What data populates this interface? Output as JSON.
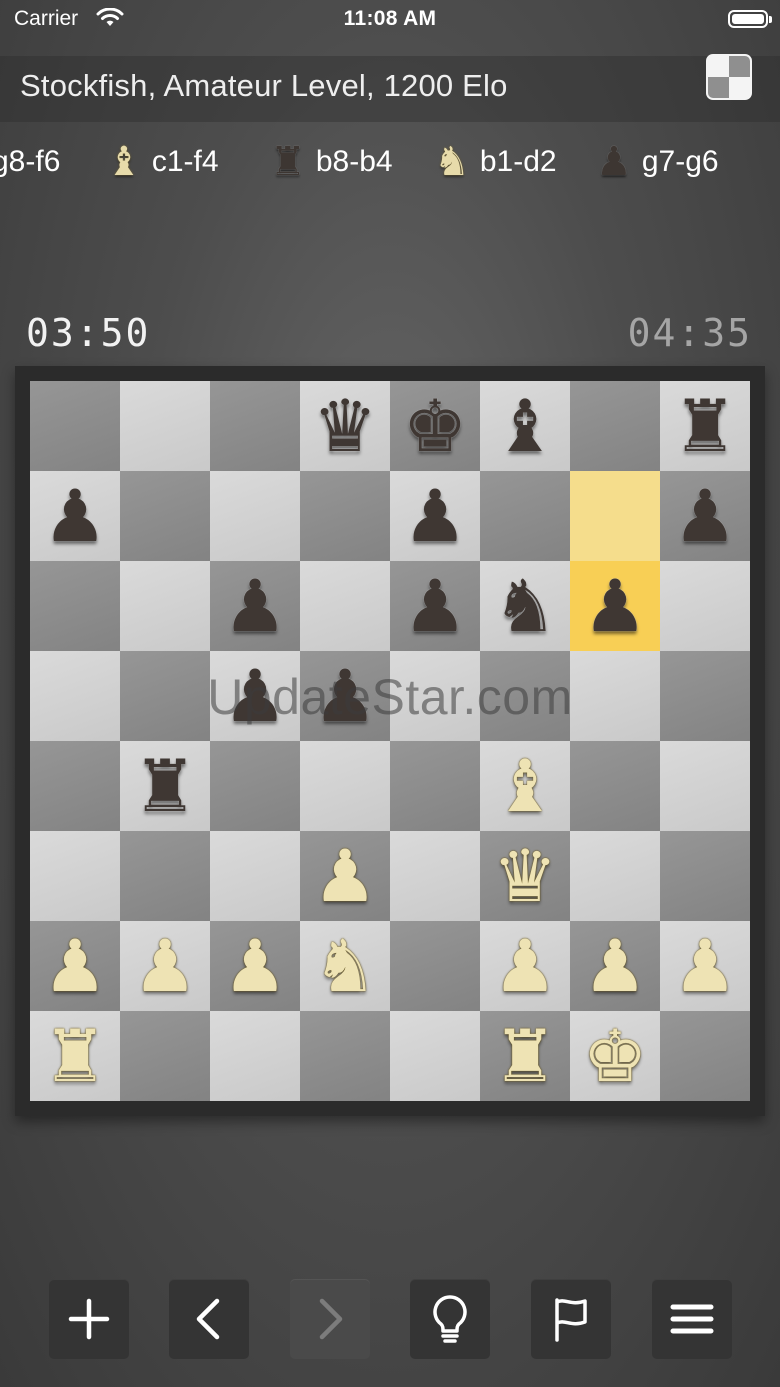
{
  "status_bar": {
    "carrier": "Carrier",
    "time": "11:08 AM"
  },
  "header": {
    "title": "Stockfish, Amateur Level, 1200 Elo"
  },
  "moves": [
    {
      "text": "g8-f6",
      "piece_icon": "none",
      "color": "black"
    },
    {
      "text": "c1-f4",
      "piece_icon": "bishop-icon",
      "color": "white"
    },
    {
      "text": "b8-b4",
      "piece_icon": "rook-icon",
      "color": "black"
    },
    {
      "text": "b1-d2",
      "piece_icon": "knight-icon",
      "color": "white"
    },
    {
      "text": "g7-g6",
      "piece_icon": "pawn-icon",
      "color": "black"
    }
  ],
  "timers": {
    "black": "03:50",
    "white": "04:35"
  },
  "board": {
    "last_move": {
      "from": "g7",
      "to": "g6"
    },
    "pieces": [
      {
        "square": "d8",
        "type": "queen",
        "color": "black"
      },
      {
        "square": "e8",
        "type": "king",
        "color": "black"
      },
      {
        "square": "f8",
        "type": "bishop",
        "color": "black"
      },
      {
        "square": "h8",
        "type": "rook",
        "color": "black"
      },
      {
        "square": "a7",
        "type": "pawn",
        "color": "black"
      },
      {
        "square": "e7",
        "type": "pawn",
        "color": "black"
      },
      {
        "square": "h7",
        "type": "pawn",
        "color": "black"
      },
      {
        "square": "c6",
        "type": "pawn",
        "color": "black"
      },
      {
        "square": "e6",
        "type": "pawn",
        "color": "black"
      },
      {
        "square": "f6",
        "type": "knight",
        "color": "black"
      },
      {
        "square": "g6",
        "type": "pawn",
        "color": "black"
      },
      {
        "square": "c5",
        "type": "pawn",
        "color": "black"
      },
      {
        "square": "d5",
        "type": "pawn",
        "color": "black"
      },
      {
        "square": "b4",
        "type": "rook",
        "color": "black"
      },
      {
        "square": "f4",
        "type": "bishop",
        "color": "white"
      },
      {
        "square": "d3",
        "type": "pawn",
        "color": "white"
      },
      {
        "square": "f3",
        "type": "queen",
        "color": "white"
      },
      {
        "square": "a2",
        "type": "pawn",
        "color": "white"
      },
      {
        "square": "b2",
        "type": "pawn",
        "color": "white"
      },
      {
        "square": "c2",
        "type": "pawn",
        "color": "white"
      },
      {
        "square": "d2",
        "type": "knight",
        "color": "white"
      },
      {
        "square": "f2",
        "type": "pawn",
        "color": "white"
      },
      {
        "square": "g2",
        "type": "pawn",
        "color": "white"
      },
      {
        "square": "h2",
        "type": "pawn",
        "color": "white"
      },
      {
        "square": "a1",
        "type": "rook",
        "color": "white"
      },
      {
        "square": "f1",
        "type": "rook",
        "color": "white"
      },
      {
        "square": "g1",
        "type": "king",
        "color": "white"
      }
    ]
  },
  "watermark": "UpdateStar.com",
  "toolbar": [
    {
      "name": "new-game-button",
      "icon": "plus-icon",
      "enabled": true
    },
    {
      "name": "back-button",
      "icon": "chevron-left-icon",
      "enabled": true
    },
    {
      "name": "forward-button",
      "icon": "chevron-right-icon",
      "enabled": false
    },
    {
      "name": "hint-button",
      "icon": "lightbulb-icon",
      "enabled": true
    },
    {
      "name": "resign-button",
      "icon": "flag-icon",
      "enabled": true
    },
    {
      "name": "menu-button",
      "icon": "hamburger-menu-icon",
      "enabled": true
    }
  ]
}
